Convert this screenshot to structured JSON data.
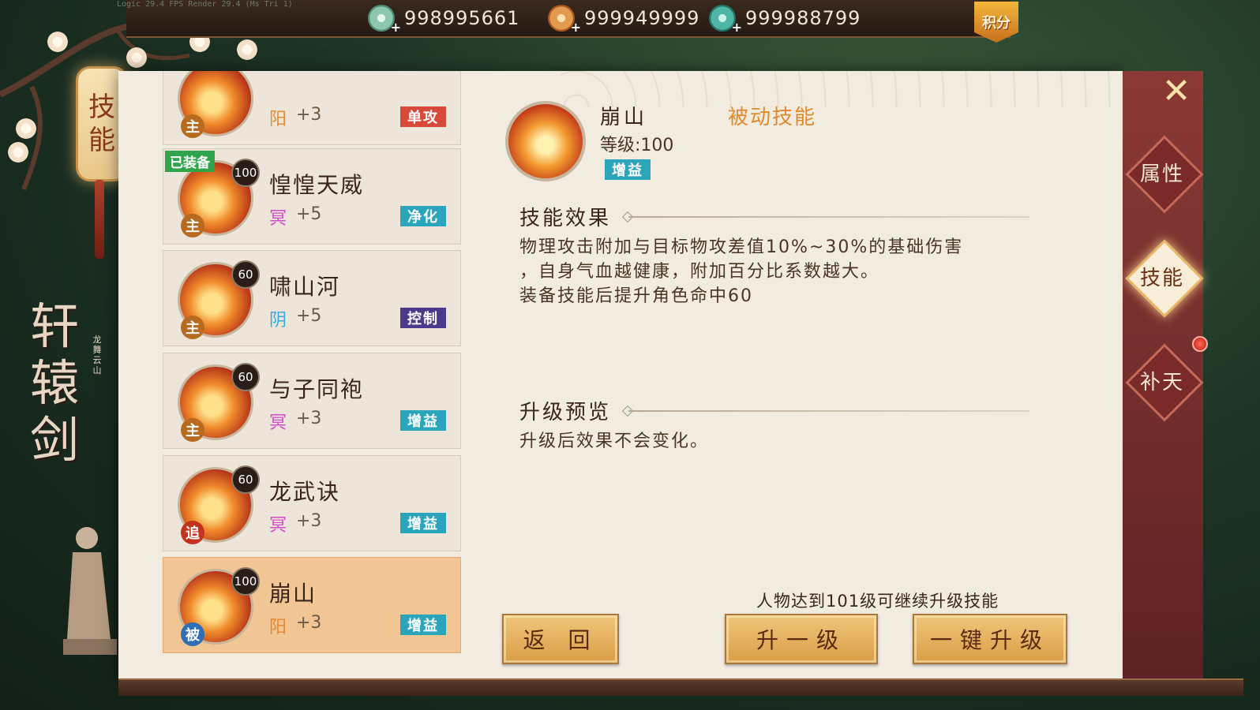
{
  "debug": "Logic 29.4 FPS Render 29.4 (Ms Tri 1)",
  "currencies": [
    {
      "icon": "jade-coin-icon",
      "value": "998995661"
    },
    {
      "icon": "copper-coin-icon",
      "value": "999949999"
    },
    {
      "icon": "dragon-token-icon",
      "value": "999988799"
    }
  ],
  "points_label": "积分",
  "lantern_tab": [
    "技",
    "能"
  ],
  "logo": {
    "title": "轩辕剑",
    "subtitle": "龙舞云山"
  },
  "side_tabs": [
    {
      "label": "属性",
      "active": false
    },
    {
      "label": "技能",
      "active": true
    },
    {
      "label": "补天",
      "active": false
    }
  ],
  "skills": [
    {
      "name": "",
      "level": "",
      "type": "主",
      "attr": "阳",
      "bonus": "+3",
      "tag": "单攻",
      "equipped": false
    },
    {
      "name": "惶惶天威",
      "level": "100",
      "type": "主",
      "attr": "冥",
      "bonus": "+5",
      "tag": "净化",
      "equipped": true
    },
    {
      "name": "啸山河",
      "level": "60",
      "type": "主",
      "attr": "阴",
      "bonus": "+5",
      "tag": "控制",
      "equipped": false
    },
    {
      "name": "与子同袍",
      "level": "60",
      "type": "主",
      "attr": "冥",
      "bonus": "+3",
      "tag": "增益",
      "equipped": false
    },
    {
      "name": "龙武诀",
      "level": "60",
      "type": "追",
      "attr": "冥",
      "bonus": "+3",
      "tag": "增益",
      "equipped": false
    },
    {
      "name": "崩山",
      "level": "100",
      "type": "被",
      "attr": "阳",
      "bonus": "+3",
      "tag": "增益",
      "equipped": false,
      "selected": true
    }
  ],
  "equipped_label": "已装备",
  "detail": {
    "name": "崩山",
    "kind": "被动技能",
    "level": "等级:100",
    "tag": "增益",
    "effect_title": "技能效果",
    "effect_lines": [
      "物理攻击附加与目标物攻差值10%~30%的基础伤害",
      "，自身气血越健康，附加百分比系数越大。",
      "装备技能后提升角色命中60"
    ],
    "upgrade_title": "升级预览",
    "upgrade_text": "升级后效果不会变化。"
  },
  "hint": "人物达到101级可继续升级技能",
  "buttons": {
    "back": "返 回",
    "upgrade_one": "升一级",
    "upgrade_all": "一键升级"
  }
}
